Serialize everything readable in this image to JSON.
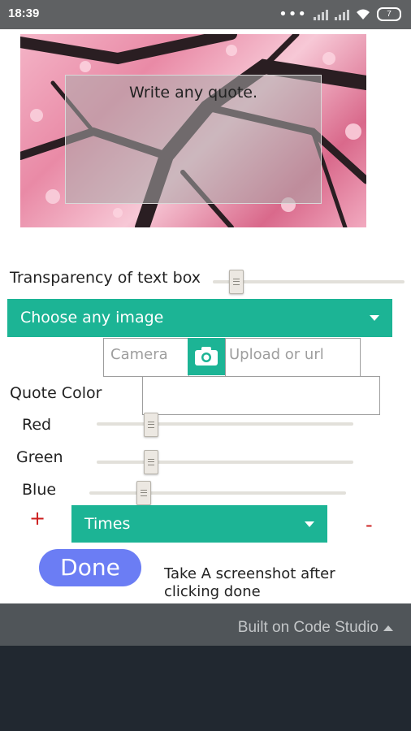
{
  "status_bar": {
    "time": "18:39",
    "battery": "7"
  },
  "preview": {
    "quote_text": "Write any quote."
  },
  "transparency": {
    "label": "Transparency of text box",
    "level": 0.12
  },
  "image_select": {
    "selected": "Choose any image"
  },
  "camera": {
    "placeholder": "Camera"
  },
  "upload": {
    "placeholder": "Upload or url"
  },
  "quote_color": {
    "label": "Quote Color",
    "value": ""
  },
  "color_sliders": [
    {
      "label": "Red",
      "level": 0.21
    },
    {
      "label": "Green",
      "level": 0.21
    },
    {
      "label": "Blue",
      "level": 0.21
    }
  ],
  "font": {
    "plus": "+",
    "selected": "Times",
    "minus": "-"
  },
  "done": {
    "label": "Done"
  },
  "note": "Take A screenshot after clicking done",
  "footer": {
    "text": "Built on Code Studio"
  },
  "colors": {
    "accent": "#1cb495",
    "done_button": "#6b7df4",
    "plus_minus": "#cc1f1f"
  }
}
